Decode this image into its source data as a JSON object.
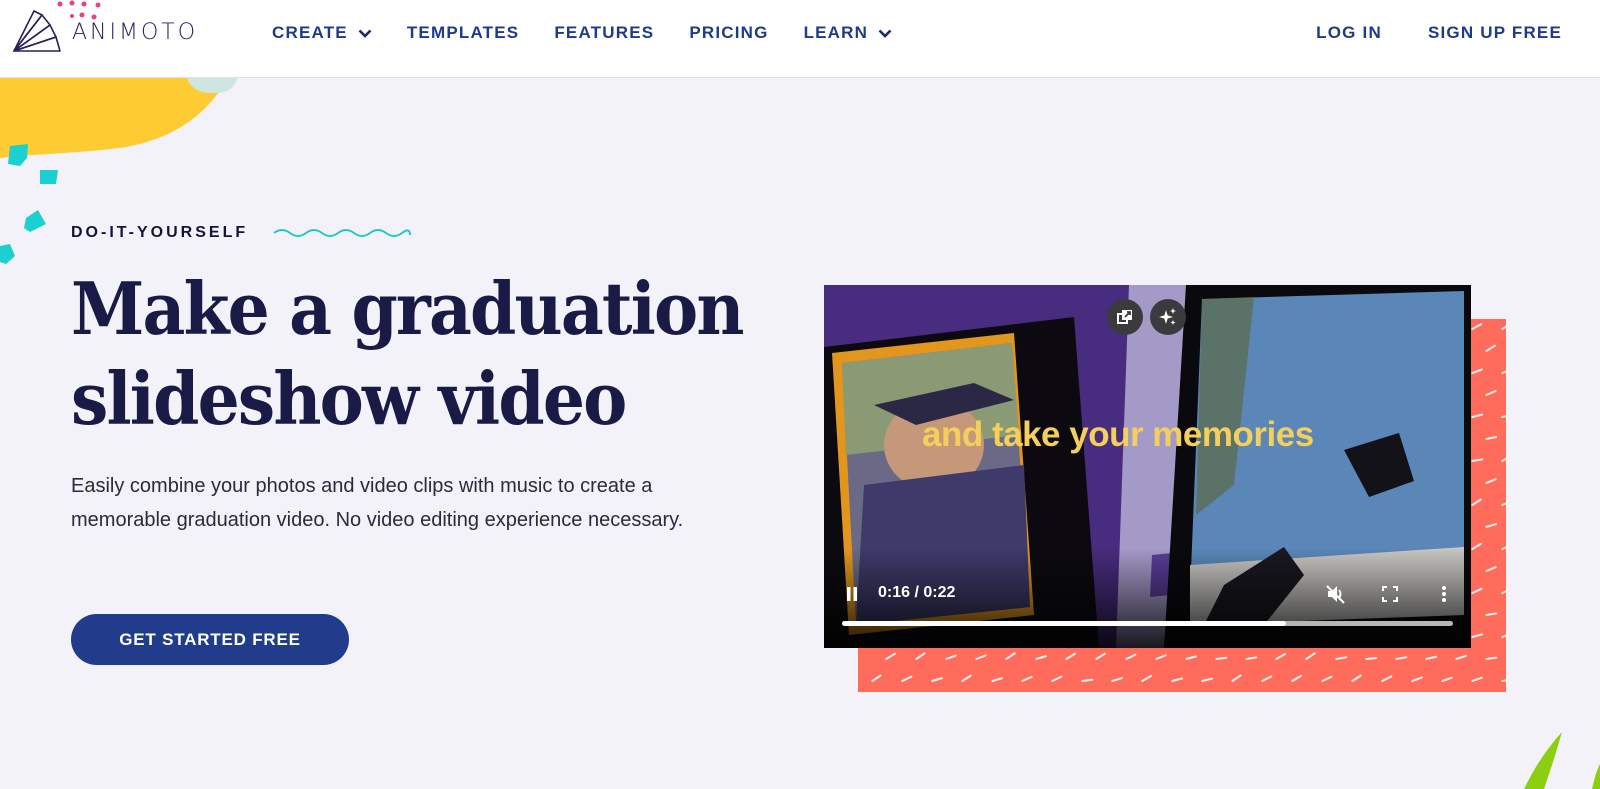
{
  "header": {
    "logo_text": "ANIMOTO",
    "nav": [
      {
        "label": "CREATE",
        "has_dropdown": true
      },
      {
        "label": "TEMPLATES",
        "has_dropdown": false
      },
      {
        "label": "FEATURES",
        "has_dropdown": false
      },
      {
        "label": "PRICING",
        "has_dropdown": false
      },
      {
        "label": "LEARN",
        "has_dropdown": true
      }
    ],
    "login_label": "LOG IN",
    "signup_label": "SIGN UP FREE"
  },
  "hero": {
    "eyebrow": "DO-IT-YOURSELF",
    "headline_line1": "Make a graduation",
    "headline_line2": "slideshow video",
    "description": "Easily combine your photos and video clips with music to create a memorable graduation video. No video editing experience necessary.",
    "cta_label": "GET STARTED FREE"
  },
  "video": {
    "caption": "and take your memories",
    "time_display": "0:16 / 0:22",
    "progress_fraction": 0.727,
    "icons": {
      "pip": "picture-in-picture-icon",
      "sparkle": "sparkle-icon",
      "pause": "pause-icon",
      "mute": "muted-volume-icon",
      "fullscreen": "fullscreen-icon",
      "more": "more-vertical-icon"
    }
  },
  "colors": {
    "brand_navy": "#1e3a8a",
    "cta_blue": "#213c8a",
    "headline": "#1a1a46",
    "accent_yellow": "#ffcb33",
    "accent_teal": "#1ccfd1",
    "coral": "#ff6c5c",
    "caption_yellow": "#f5cf5b"
  }
}
